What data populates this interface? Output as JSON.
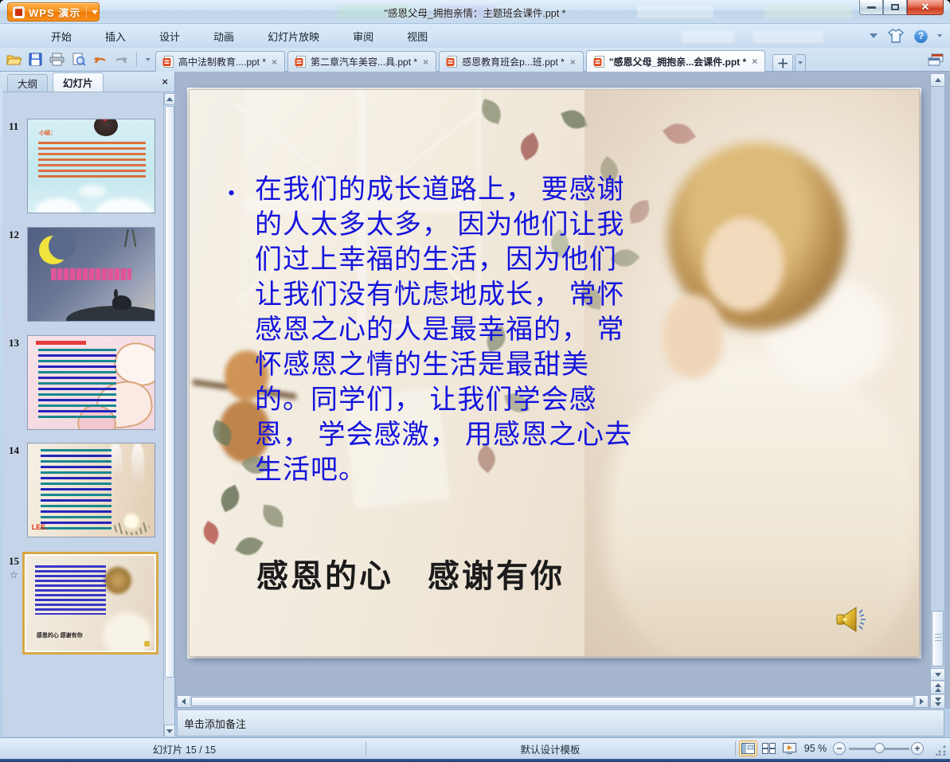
{
  "window": {
    "app_button_label": "WPS 演示",
    "title": "\"感恩父母_拥抱亲情：主题班会课件.ppt *"
  },
  "menu_tabs": [
    "开始",
    "插入",
    "设计",
    "动画",
    "幻灯片放映",
    "审阅",
    "视图"
  ],
  "doc_tabs": [
    {
      "label": "高中法制教育....ppt *"
    },
    {
      "label": "第二章汽车美容...具.ppt *"
    },
    {
      "label": "感恩教育班会p...班.ppt *"
    },
    {
      "label": "\"感恩父母_拥抱亲...会课件.ppt *"
    }
  ],
  "sidebar": {
    "outline_tab": "大纲",
    "slides_tab": "幻灯片",
    "slides": [
      {
        "number": "11",
        "caption": "小结："
      },
      {
        "number": "12"
      },
      {
        "number": "13"
      },
      {
        "number": "14"
      },
      {
        "number": "15",
        "mini_title": "感恩的心  感谢有你"
      }
    ]
  },
  "slide": {
    "bullet": "•",
    "body": "在我们的成长道路上， 要感谢的人太多太多， 因为他们让我们过上幸福的生活，因为他们让我们没有忧虑地成长， 常怀感恩之心的人是最幸福的， 常怀感恩之情的生活是最甜美的。同学们， 让我们学会感恩， 学会感激， 用感恩之心去生活吧。",
    "title": "感恩的心　感谢有你"
  },
  "notes": {
    "placeholder": "单击添加备注"
  },
  "status": {
    "slide_indicator": "幻灯片 15 / 15",
    "template_name": "默认设计模板",
    "zoom_level": "95 %"
  },
  "icons": {
    "close_glyph": "✕",
    "tab_close_glyph": "×",
    "panel_close_glyph": "×",
    "help_glyph": "?",
    "plus_glyph": "＋",
    "star_glyph": "☆",
    "zoom_out_glyph": "−",
    "zoom_in_glyph": "+"
  },
  "colors": {
    "accent_orange": "#f0841e",
    "slide_text_blue": "#1414dd",
    "selection_gold": "#d9a843",
    "close_red": "#ce3c20"
  }
}
